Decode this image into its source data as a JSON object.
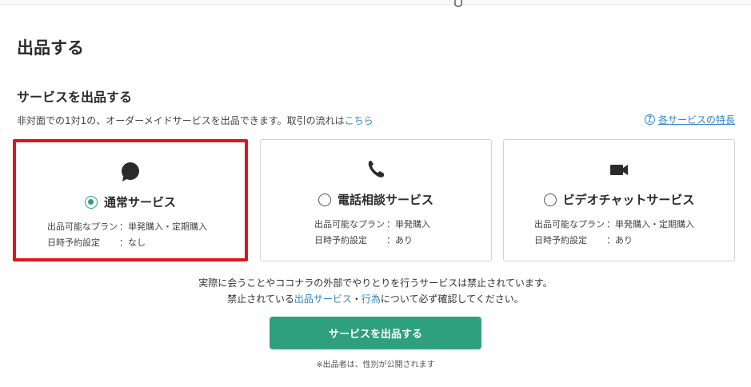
{
  "page": {
    "title": "出品する"
  },
  "section": {
    "title": "サービスを出品する",
    "description": "非対面での1対1の、オーダーメイドサービスを出品できます。取引の流れは",
    "flow_link": "こちら",
    "features_link": "各サービスの特長"
  },
  "cards": [
    {
      "title": "通常サービス",
      "icon": "chat-bubble-icon",
      "selected": true,
      "plan_label": "出品可能なプラン",
      "plan_value": "：単発購入・定期購入",
      "schedule_label": "日時予約設定",
      "schedule_value": "：なし"
    },
    {
      "title": "電話相談サービス",
      "icon": "phone-icon",
      "selected": false,
      "plan_label": "出品可能なプラン",
      "plan_value": "：単発購入",
      "schedule_label": "日時予約設定",
      "schedule_value": "：あり"
    },
    {
      "title": "ビデオチャットサービス",
      "icon": "video-camera-icon",
      "selected": false,
      "plan_label": "出品可能なプラン",
      "plan_value": "：単発購入・定期購入",
      "schedule_label": "日時予約設定",
      "schedule_value": "：あり"
    }
  ],
  "notice": {
    "line1": "実際に会うことやココナラの外部でやりとりを行うサービスは禁止されています。",
    "line2_prefix": "禁止されている",
    "link_services": "出品サービス",
    "separator": "・",
    "link_acts": "行為",
    "line2_suffix": "について必ず確認してください。"
  },
  "submit_label": "サービスを出品する",
  "footnote": "※出品者は、性別が公開されます",
  "colors": {
    "accent": "#2ea07c",
    "link": "#2f86c9",
    "highlight": "#e0141e"
  }
}
